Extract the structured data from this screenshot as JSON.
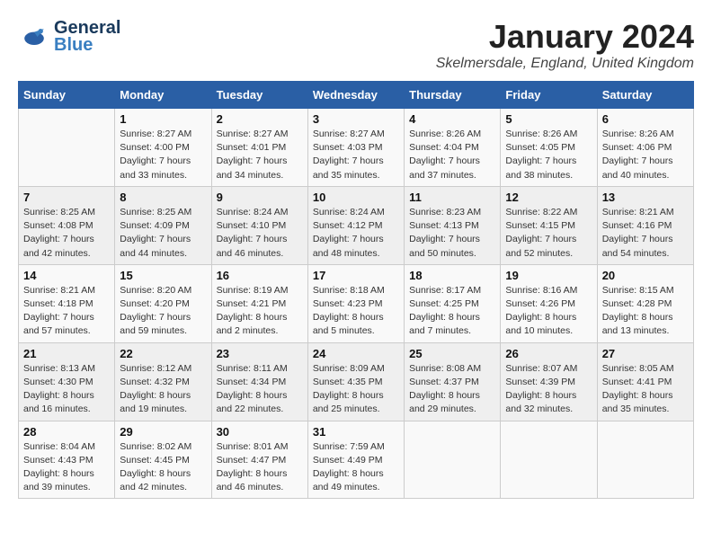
{
  "header": {
    "logo_general": "General",
    "logo_blue": "Blue",
    "title": "January 2024",
    "subtitle": "Skelmersdale, England, United Kingdom"
  },
  "weekdays": [
    "Sunday",
    "Monday",
    "Tuesday",
    "Wednesday",
    "Thursday",
    "Friday",
    "Saturday"
  ],
  "weeks": [
    [
      {
        "day": "",
        "info": ""
      },
      {
        "day": "1",
        "info": "Sunrise: 8:27 AM\nSunset: 4:00 PM\nDaylight: 7 hours\nand 33 minutes."
      },
      {
        "day": "2",
        "info": "Sunrise: 8:27 AM\nSunset: 4:01 PM\nDaylight: 7 hours\nand 34 minutes."
      },
      {
        "day": "3",
        "info": "Sunrise: 8:27 AM\nSunset: 4:03 PM\nDaylight: 7 hours\nand 35 minutes."
      },
      {
        "day": "4",
        "info": "Sunrise: 8:26 AM\nSunset: 4:04 PM\nDaylight: 7 hours\nand 37 minutes."
      },
      {
        "day": "5",
        "info": "Sunrise: 8:26 AM\nSunset: 4:05 PM\nDaylight: 7 hours\nand 38 minutes."
      },
      {
        "day": "6",
        "info": "Sunrise: 8:26 AM\nSunset: 4:06 PM\nDaylight: 7 hours\nand 40 minutes."
      }
    ],
    [
      {
        "day": "7",
        "info": "Sunrise: 8:25 AM\nSunset: 4:08 PM\nDaylight: 7 hours\nand 42 minutes."
      },
      {
        "day": "8",
        "info": "Sunrise: 8:25 AM\nSunset: 4:09 PM\nDaylight: 7 hours\nand 44 minutes."
      },
      {
        "day": "9",
        "info": "Sunrise: 8:24 AM\nSunset: 4:10 PM\nDaylight: 7 hours\nand 46 minutes."
      },
      {
        "day": "10",
        "info": "Sunrise: 8:24 AM\nSunset: 4:12 PM\nDaylight: 7 hours\nand 48 minutes."
      },
      {
        "day": "11",
        "info": "Sunrise: 8:23 AM\nSunset: 4:13 PM\nDaylight: 7 hours\nand 50 minutes."
      },
      {
        "day": "12",
        "info": "Sunrise: 8:22 AM\nSunset: 4:15 PM\nDaylight: 7 hours\nand 52 minutes."
      },
      {
        "day": "13",
        "info": "Sunrise: 8:21 AM\nSunset: 4:16 PM\nDaylight: 7 hours\nand 54 minutes."
      }
    ],
    [
      {
        "day": "14",
        "info": "Sunrise: 8:21 AM\nSunset: 4:18 PM\nDaylight: 7 hours\nand 57 minutes."
      },
      {
        "day": "15",
        "info": "Sunrise: 8:20 AM\nSunset: 4:20 PM\nDaylight: 7 hours\nand 59 minutes."
      },
      {
        "day": "16",
        "info": "Sunrise: 8:19 AM\nSunset: 4:21 PM\nDaylight: 8 hours\nand 2 minutes."
      },
      {
        "day": "17",
        "info": "Sunrise: 8:18 AM\nSunset: 4:23 PM\nDaylight: 8 hours\nand 5 minutes."
      },
      {
        "day": "18",
        "info": "Sunrise: 8:17 AM\nSunset: 4:25 PM\nDaylight: 8 hours\nand 7 minutes."
      },
      {
        "day": "19",
        "info": "Sunrise: 8:16 AM\nSunset: 4:26 PM\nDaylight: 8 hours\nand 10 minutes."
      },
      {
        "day": "20",
        "info": "Sunrise: 8:15 AM\nSunset: 4:28 PM\nDaylight: 8 hours\nand 13 minutes."
      }
    ],
    [
      {
        "day": "21",
        "info": "Sunrise: 8:13 AM\nSunset: 4:30 PM\nDaylight: 8 hours\nand 16 minutes."
      },
      {
        "day": "22",
        "info": "Sunrise: 8:12 AM\nSunset: 4:32 PM\nDaylight: 8 hours\nand 19 minutes."
      },
      {
        "day": "23",
        "info": "Sunrise: 8:11 AM\nSunset: 4:34 PM\nDaylight: 8 hours\nand 22 minutes."
      },
      {
        "day": "24",
        "info": "Sunrise: 8:09 AM\nSunset: 4:35 PM\nDaylight: 8 hours\nand 25 minutes."
      },
      {
        "day": "25",
        "info": "Sunrise: 8:08 AM\nSunset: 4:37 PM\nDaylight: 8 hours\nand 29 minutes."
      },
      {
        "day": "26",
        "info": "Sunrise: 8:07 AM\nSunset: 4:39 PM\nDaylight: 8 hours\nand 32 minutes."
      },
      {
        "day": "27",
        "info": "Sunrise: 8:05 AM\nSunset: 4:41 PM\nDaylight: 8 hours\nand 35 minutes."
      }
    ],
    [
      {
        "day": "28",
        "info": "Sunrise: 8:04 AM\nSunset: 4:43 PM\nDaylight: 8 hours\nand 39 minutes."
      },
      {
        "day": "29",
        "info": "Sunrise: 8:02 AM\nSunset: 4:45 PM\nDaylight: 8 hours\nand 42 minutes."
      },
      {
        "day": "30",
        "info": "Sunrise: 8:01 AM\nSunset: 4:47 PM\nDaylight: 8 hours\nand 46 minutes."
      },
      {
        "day": "31",
        "info": "Sunrise: 7:59 AM\nSunset: 4:49 PM\nDaylight: 8 hours\nand 49 minutes."
      },
      {
        "day": "",
        "info": ""
      },
      {
        "day": "",
        "info": ""
      },
      {
        "day": "",
        "info": ""
      }
    ]
  ]
}
